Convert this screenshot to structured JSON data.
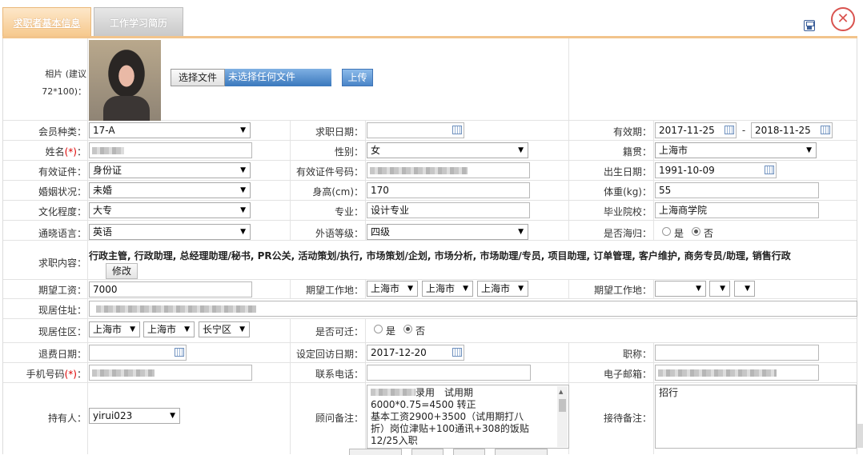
{
  "tabs": {
    "basic_info": "求职者基本信息",
    "work_history": "工作学习简历"
  },
  "photo": {
    "label": "相片 (建议72*100)：",
    "choose_file": "选择文件",
    "no_file": "未选择任何文件",
    "upload": "上传"
  },
  "labels": {
    "member_type": "会员种类：",
    "job_date": "求职日期：",
    "validity": "有效期：",
    "name": "姓名",
    "gender": "性别：",
    "native": "籍贯：",
    "id_type": "有效证件：",
    "id_number": "有效证件号码：",
    "birth": "出生日期：",
    "marital": "婚姻状况：",
    "height": "身高(cm)：",
    "weight": "体重(kg)：",
    "education": "文化程度：",
    "major": "专业：",
    "school": "毕业院校：",
    "language": "通晓语言：",
    "foreign_level": "外语等级：",
    "overseas": "是否海归：",
    "job_content": "求职内容：",
    "expected_salary": "期望工资：",
    "expected_place": "期望工作地：",
    "expected_place2": "期望工作地：",
    "address": "现居住址：",
    "district": "现居住区：",
    "relocate": "是否可迁：",
    "refund_date": "退费日期：",
    "revisit_date": "设定回访日期：",
    "title": "职称：",
    "mobile": "手机号码",
    "phone": "联系电话：",
    "email": "电子邮箱：",
    "holder": "持有人：",
    "consultant_note": "顾问备注：",
    "reception_note": "接待备注："
  },
  "required_mark": "(*)",
  "colon": "：",
  "values": {
    "member_type": "17-A",
    "validity_from": "2017-11-25",
    "validity_dash": "-",
    "validity_to": "2018-11-25",
    "gender": "女",
    "native": "上海市",
    "id_type": "身份证",
    "birth": "1991-10-09",
    "marital": "未婚",
    "height": "170",
    "weight": "55",
    "education": "大专",
    "major": "设计专业",
    "school": "上海商学院",
    "language": "英语",
    "foreign_level": "四级",
    "yes": "是",
    "no": "否",
    "job_content": "行政主管, 行政助理, 总经理助理/秘书, PR公关, 活动策划/执行, 市场策划/企划, 市场分析, 市场助理/专员, 项目助理, 订单管理, 客户维护, 商务专员/助理, 销售行政",
    "edit": "修改",
    "expected_salary": "7000",
    "place1": "上海市",
    "place2": "上海市",
    "place3": "上海市",
    "district1": "上海市",
    "district2": "上海市",
    "district3": "长宁区",
    "revisit_date": "2017-12-20",
    "holder": "yirui023",
    "consultant_note_lines": [
      "录用　试用期",
      "6000*0.75=4500 转正",
      "基本工资2900+3500（试用期打八",
      "折）岗位津贴+100通讯+308的饭贴",
      "12/25入职"
    ],
    "reception_note": "招行"
  }
}
